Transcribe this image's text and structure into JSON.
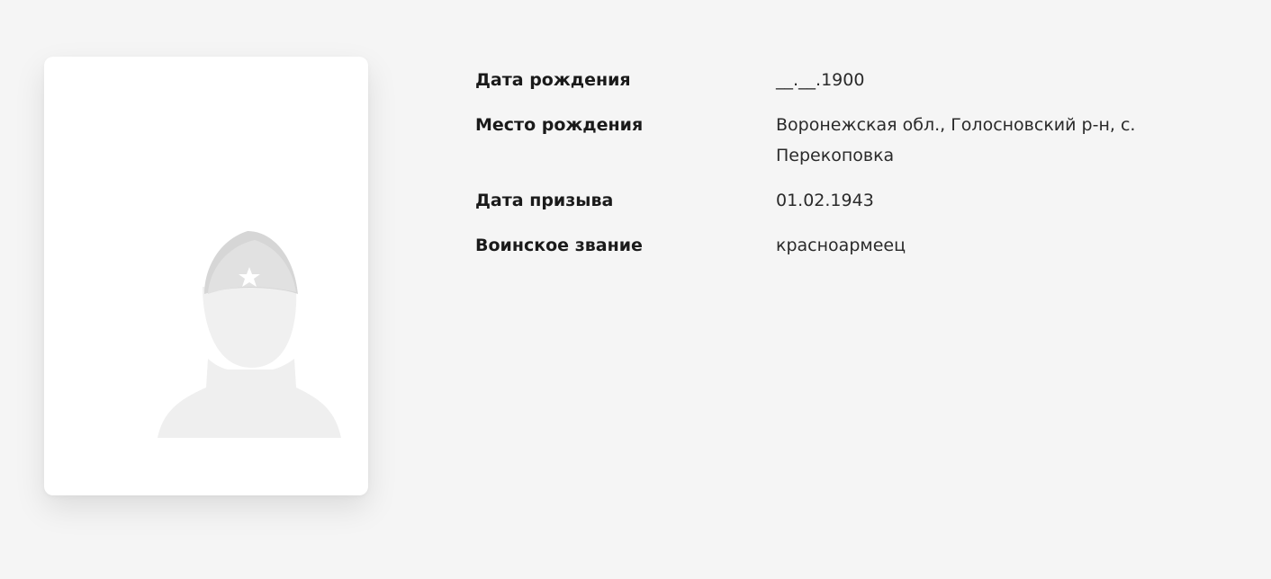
{
  "profile": {
    "photo_placeholder": "soldier-silhouette-icon"
  },
  "info": {
    "rows": [
      {
        "label": "Дата рождения",
        "value": "__.__.1900"
      },
      {
        "label": "Место рождения",
        "value": "Воронежская обл., Голосновский р-н, с. Перекоповка"
      },
      {
        "label": "Дата призыва",
        "value": "01.02.1943"
      },
      {
        "label": "Воинское звание",
        "value": "красноармеец"
      }
    ]
  },
  "colors": {
    "background": "#f5f5f5",
    "card": "#ffffff",
    "label_text": "#1a1a1a",
    "value_text": "#2a2a2a"
  }
}
